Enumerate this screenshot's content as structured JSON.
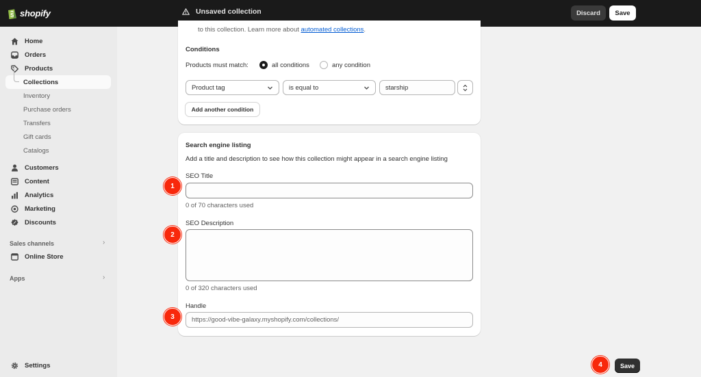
{
  "topbar": {
    "brand": "shopify",
    "title": "Unsaved collection",
    "discard_label": "Discard",
    "save_label": "Save"
  },
  "sidebar": {
    "items": [
      {
        "label": "Home",
        "icon": "home-icon"
      },
      {
        "label": "Orders",
        "icon": "inbox-icon"
      },
      {
        "label": "Products",
        "icon": "tag-icon"
      }
    ],
    "products_sub": [
      {
        "label": "Collections",
        "active": true
      },
      {
        "label": "Inventory"
      },
      {
        "label": "Purchase orders"
      },
      {
        "label": "Transfers"
      },
      {
        "label": "Gift cards"
      },
      {
        "label": "Catalogs"
      }
    ],
    "items2": [
      {
        "label": "Customers",
        "icon": "person-icon"
      },
      {
        "label": "Content",
        "icon": "content-icon"
      },
      {
        "label": "Analytics",
        "icon": "chart-icon"
      },
      {
        "label": "Marketing",
        "icon": "target-icon"
      },
      {
        "label": "Discounts",
        "icon": "discount-icon"
      }
    ],
    "sales_channels_title": "Sales channels",
    "online_store": "Online Store",
    "apps_title": "Apps",
    "settings": "Settings"
  },
  "conditions_card": {
    "intro_prefix": "to this collection. Learn more about ",
    "intro_link": "automated collections",
    "intro_suffix": ".",
    "heading": "Conditions",
    "match_label": "Products must match:",
    "option_all": "all conditions",
    "option_any": "any condition",
    "selected": "all conditions",
    "condition_field": "Product tag",
    "condition_operator": "is equal to",
    "condition_value": "starship",
    "add_condition_label": "Add another condition"
  },
  "seo_card": {
    "heading": "Search engine listing",
    "description": "Add a title and description to see how this collection might appear in a search engine listing",
    "title_label": "SEO Title",
    "title_value": "",
    "title_help": "0 of 70 characters used",
    "desc_label": "SEO Description",
    "desc_value": "",
    "desc_help": "0 of 320 characters used",
    "handle_label": "Handle",
    "handle_value": "https://good-vibe-galaxy.myshopify.com/collections/"
  },
  "annotations": [
    "1",
    "2",
    "3",
    "4"
  ],
  "footer": {
    "save_label": "Save"
  },
  "colors": {
    "badge": "#f8280b",
    "topbar": "#1a1a1a",
    "link": "#005bd3"
  }
}
